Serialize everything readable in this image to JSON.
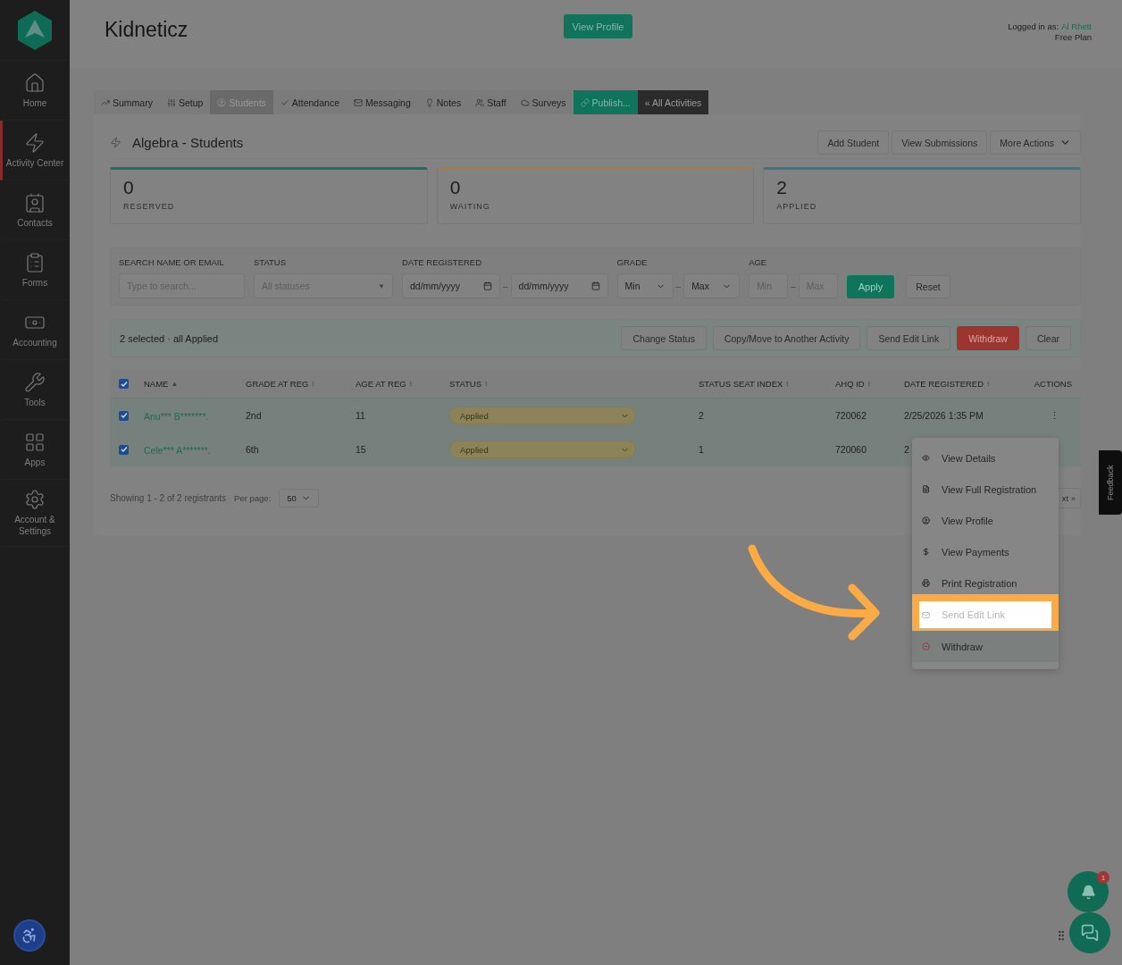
{
  "app": {
    "title": "Kidneticz",
    "view_profile_button": "View Profile",
    "login_label": "Logged in as:",
    "login_user": "Al Rhett",
    "plan": "Free Plan"
  },
  "sidebar": {
    "items": [
      {
        "label": "Home",
        "kind": "home",
        "selected": false
      },
      {
        "label": "Activity Center",
        "kind": "activity",
        "selected": true
      },
      {
        "label": "Contacts",
        "kind": "contacts",
        "selected": false
      },
      {
        "label": "Forms",
        "kind": "forms",
        "selected": false
      },
      {
        "label": "Accounting",
        "kind": "accounting",
        "selected": false
      },
      {
        "label": "Tools",
        "kind": "tools",
        "selected": false
      },
      {
        "label": "Apps",
        "kind": "apps",
        "selected": false
      },
      {
        "label": "Account & Settings",
        "kind": "settings",
        "selected": false
      }
    ]
  },
  "tabs": [
    {
      "label": "Summary",
      "kind": "summary",
      "selected": false
    },
    {
      "label": "Setup",
      "kind": "setup",
      "selected": false
    },
    {
      "label": "Students",
      "kind": "students",
      "selected": true
    },
    {
      "label": "Attendance",
      "kind": "attendance",
      "selected": false
    },
    {
      "label": "Messaging",
      "kind": "messaging",
      "selected": false
    },
    {
      "label": "Notes",
      "kind": "notes",
      "selected": false
    },
    {
      "label": "Staff",
      "kind": "staff",
      "selected": false
    },
    {
      "label": "Surveys",
      "kind": "surveys",
      "selected": false
    },
    {
      "label": "Publish...",
      "kind": "publish",
      "selected": false
    },
    {
      "label": "« All Activities",
      "kind": "back",
      "selected": false
    }
  ],
  "section": {
    "title": "Algebra - Students",
    "buttons": [
      "Add Student",
      "View Submissions"
    ],
    "more_actions": "More Actions"
  },
  "stats": [
    {
      "value": "0",
      "label": "RESERVED",
      "color": "#1d6f5c"
    },
    {
      "value": "0",
      "label": "WAITING",
      "color": "#a27c47"
    },
    {
      "value": "2",
      "label": "APPLIED",
      "color": "#3a7686"
    }
  ],
  "filters": {
    "search_label": "SEARCH NAME OR EMAIL",
    "search_placeholder": "Type to search...",
    "status_label": "STATUS",
    "status_placeholder": "All statuses",
    "status_caret": "▼",
    "date_separator": "–",
    "grade_separator": "–",
    "age_separator": "–",
    "date_label": "DATE REGISTERED",
    "date_from": "dd/mm/yyyy",
    "date_to": "dd/mm/yyyy",
    "grade_label": "GRADE",
    "grade_min": "Min",
    "grade_max": "Max",
    "age_label": "AGE",
    "age_min_placeholder": "Min",
    "age_max_placeholder": "Max",
    "apply": "Apply",
    "reset": "Reset"
  },
  "selection": {
    "summary": "2 selected · all Applied",
    "actions": [
      {
        "label": "Change Status",
        "kind": "default"
      },
      {
        "label": "Copy/Move to Another Activity",
        "kind": "default"
      },
      {
        "label": "Send Edit Link",
        "kind": "default"
      },
      {
        "label": "Withdraw",
        "kind": "danger"
      },
      {
        "label": "Clear",
        "kind": "default"
      }
    ]
  },
  "table": {
    "all_checked": true,
    "columns": [
      {
        "label": "NAME",
        "sort_mark": "▲"
      },
      {
        "label": "GRADE AT REG",
        "sort_mark": "↕"
      },
      {
        "label": "AGE AT REG",
        "sort_mark": "↕"
      },
      {
        "label": "STATUS",
        "sort_mark": "↕"
      },
      {
        "label": "STATUS SEAT INDEX",
        "sort_mark": "↕"
      },
      {
        "label": "AHQ ID",
        "sort_mark": "↕"
      },
      {
        "label": "DATE REGISTERED",
        "sort_mark": "↕"
      },
      {
        "label": "ACTIONS"
      }
    ],
    "rows": [
      {
        "checked": true,
        "name": "Anu*** B*******.",
        "grade": "2nd",
        "age": "11",
        "status": "Applied",
        "seat_index": "2",
        "ahq_id": "720062",
        "date_registered": "2/25/2026 1:35 PM",
        "actions": "⋮"
      },
      {
        "checked": true,
        "name": "Cele*** A*******.",
        "grade": "6th",
        "age": "15",
        "status": "Applied",
        "seat_index": "1",
        "ahq_id": "720060",
        "date_registered": "2"
      }
    ]
  },
  "footer": {
    "showing": "Showing 1 - 2 of 2 registrants",
    "per_page_label": "Per page:",
    "per_page": "50",
    "next": "xt »"
  },
  "menu": {
    "items": [
      {
        "label": "View Details",
        "kind": "eye",
        "highlighted": false
      },
      {
        "label": "View Full Registration",
        "kind": "file",
        "highlighted": false
      },
      {
        "label": "View Profile",
        "kind": "user",
        "highlighted": false
      },
      {
        "label": "View Payments",
        "kind": "dollar",
        "highlighted": false
      },
      {
        "label": "Print Registration",
        "kind": "printer",
        "highlighted": false
      },
      {
        "label": "Send Edit Link",
        "kind": "mail",
        "highlighted": true
      },
      {
        "label": "Withdraw",
        "kind": "withdraw",
        "highlighted": false
      }
    ]
  },
  "feedback": "Feedback",
  "notifications": {
    "count": "1"
  }
}
